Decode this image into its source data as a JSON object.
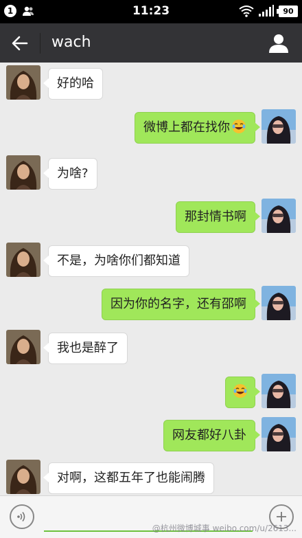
{
  "status_bar": {
    "notification_count": "1",
    "time": "11:23",
    "battery": "90"
  },
  "header": {
    "title": "wach"
  },
  "messages": [
    {
      "side": "left",
      "text": "好的哈"
    },
    {
      "side": "right",
      "text": "微博上都在找你",
      "emoji": "laughing-tears"
    },
    {
      "side": "left",
      "text": "为啥?"
    },
    {
      "side": "right",
      "text": "那封情书啊"
    },
    {
      "side": "left",
      "text": "不是，为啥你们都知道"
    },
    {
      "side": "right",
      "text": "因为你的名字，还有邵啊"
    },
    {
      "side": "left",
      "text": "我也是醉了"
    },
    {
      "side": "right",
      "text": "",
      "emoji": "laughing-tears"
    },
    {
      "side": "right",
      "text": "网友都好八卦"
    },
    {
      "side": "left",
      "text": "对啊，这都五年了也能闹腾"
    }
  ],
  "input": {
    "value": ""
  },
  "watermark": "@杭州微博城事 weibo.com/u/2613..."
}
